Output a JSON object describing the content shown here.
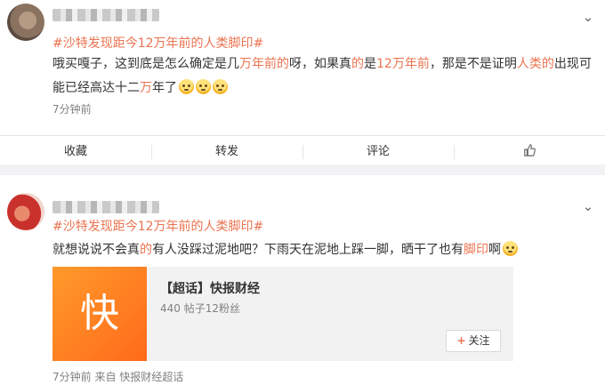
{
  "post1": {
    "topic": "#沙特发现距今12万年前的人类脚印#",
    "text_segments": [
      {
        "t": "哦买嘎子，这到底是怎么确定是几",
        "hl": false
      },
      {
        "t": "万年前的",
        "hl": true
      },
      {
        "t": "呀，如果真",
        "hl": false
      },
      {
        "t": "的",
        "hl": true
      },
      {
        "t": "是",
        "hl": false
      },
      {
        "t": "12万年前",
        "hl": true
      },
      {
        "t": "，那是不是证明",
        "hl": false
      },
      {
        "t": "人类的",
        "hl": true
      },
      {
        "t": "出现可能已经高达十二",
        "hl": false
      },
      {
        "t": "万",
        "hl": true
      },
      {
        "t": "年了",
        "hl": false
      }
    ],
    "emoji_count": 3,
    "time": "7分钟前",
    "actions": {
      "favorite": "收藏",
      "repost": "转发",
      "comment": "评论"
    }
  },
  "post2": {
    "topic": "#沙特发现距今12万年前的人类脚印#",
    "text_segments": [
      {
        "t": "就想说说不会真",
        "hl": false
      },
      {
        "t": "的",
        "hl": true
      },
      {
        "t": "有人没踩过泥地吧？下雨天在泥地上踩一脚，晒干了也有",
        "hl": false
      },
      {
        "t": "脚印",
        "hl": true
      },
      {
        "t": "啊",
        "hl": false
      }
    ],
    "card": {
      "logo_char": "快",
      "title": "【超话】快报财经",
      "subtitle": "440 帖子12粉丝",
      "follow_label": "关注",
      "follow_plus": "+"
    },
    "meta": "7分钟前  来自 快报财经超话"
  },
  "icons": {
    "chevron": "chevron-down-icon",
    "like": "thumbs-up-icon",
    "emoji": "smile-emoji-icon"
  },
  "colors": {
    "highlight": "#eb7350",
    "meta_gray": "#808080",
    "separator_bg": "#f2f2f5"
  }
}
